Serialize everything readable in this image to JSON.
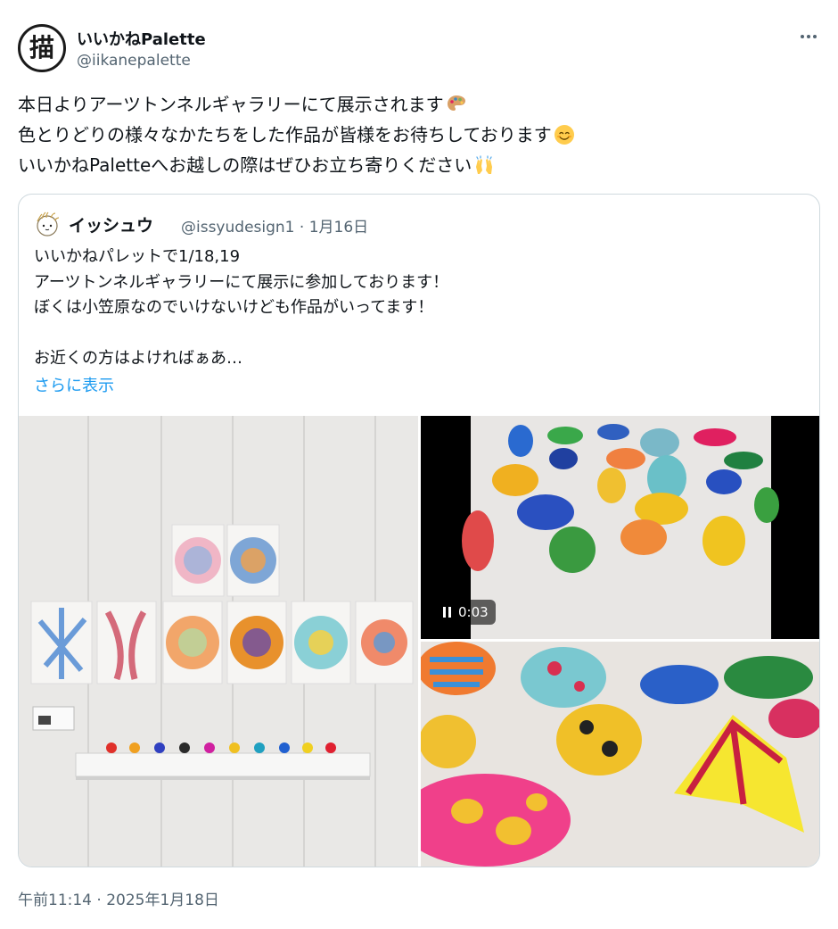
{
  "author": {
    "display_name": "いいかねPalette",
    "handle": "@iikanepalette",
    "avatar_glyph": "描",
    "avatar_icon": "brush-kanji-logo"
  },
  "more_menu_icon": "more-horizontal-icon",
  "tweet_text": {
    "line1": "本日よりアーツトンネルギャラリーにて展示されます",
    "line1_emoji": "artist-palette-emoji",
    "line2": "色とりどりの様々なかたちをした作品が皆様をお待ちしております",
    "line2_emoji": "smiling-face-emoji",
    "line3": "いいかねPaletteへお越しの際はぜひお立ち寄りください",
    "line3_emoji": "raising-hands-emoji"
  },
  "quoted_tweet": {
    "display_name": "イッシュウ",
    "handle": "@issyudesign1",
    "separator": "·",
    "date": "1月16日",
    "lines": [
      "いいかねパレットで1/18,19",
      "アーツトンネルギャラリーにて展示に参加しております！",
      "ぼくは小笠原なのでいけないけども作品がいってます！",
      "",
      "お近くの方はよければぁあ…"
    ],
    "show_more": "さらに表示",
    "media": {
      "video_time": "0:03",
      "pause_icon": "pause-icon"
    }
  },
  "timestamp": "午前11:14 · 2025年1月18日",
  "colors": {
    "text_primary": "#0f1419",
    "text_secondary": "#536471",
    "link": "#1d9bf0",
    "border": "#cfd9de"
  }
}
